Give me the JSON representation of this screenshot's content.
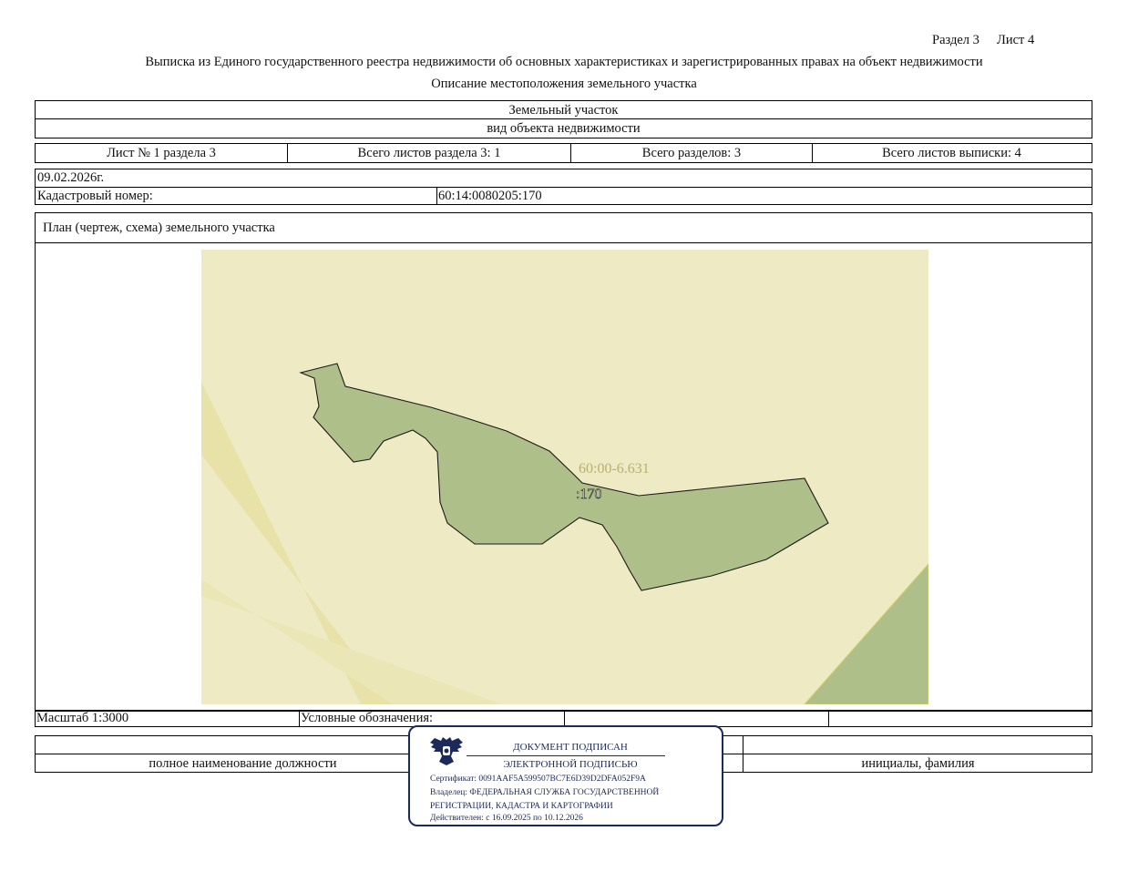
{
  "header": {
    "section": "Раздел 3",
    "sheet": "Лист 4",
    "title": "Выписка из Единого государственного реестра недвижимости об основных характеристиках и зарегистрированных правах на объект недвижимости",
    "subtitle": "Описание местоположения земельного участка"
  },
  "object": {
    "type": "Земельный участок",
    "type_caption": "вид объекта недвижимости"
  },
  "sheets_row": {
    "sheet_of_section": "Лист № 1 раздела 3",
    "total_sheets_section": "Всего листов раздела 3: 1",
    "total_sections": "Всего разделов: 3",
    "total_sheets_extract": "Всего листов выписки: 4"
  },
  "info": {
    "date": "09.02.2026г.",
    "cadastral_label": "Кадастровый номер:",
    "cadastral_value": "60:14:0080205:170"
  },
  "plan": {
    "title": "План (чертеж, схема) земельного участка",
    "quarter_label": "60:00-6.631",
    "parcel_label": ":170",
    "colors": {
      "background": "#eeeac4",
      "parcel": "#afbf8a",
      "band": "#e8e2a8"
    }
  },
  "legend_row": {
    "scale": "Масштаб 1:3000",
    "legend_label": "Условные обозначения:"
  },
  "signature_row": {
    "position_caption": "полное наименование должности",
    "initials_caption": "инициалы, фамилия"
  },
  "stamp": {
    "line1": "ДОКУМЕНТ ПОДПИСАН",
    "line2": "ЭЛЕКТРОННОЙ ПОДПИСЬЮ",
    "certificate": "Сертификат: 0091AAF5A599507BC7E6D39D2DFA052F9A",
    "owner1": "Владелец: ФЕДЕРАЛЬНАЯ СЛУЖБА ГОСУДАРСТВЕННОЙ",
    "owner2": "РЕГИСТРАЦИИ, КАДАСТРА И КАРТОГРАФИИ",
    "valid": "Действителен: с 16.09.2025 по 10.12.2026",
    "emblem_icon": "double-headed-eagle-icon",
    "color": "#1c2a5a"
  }
}
